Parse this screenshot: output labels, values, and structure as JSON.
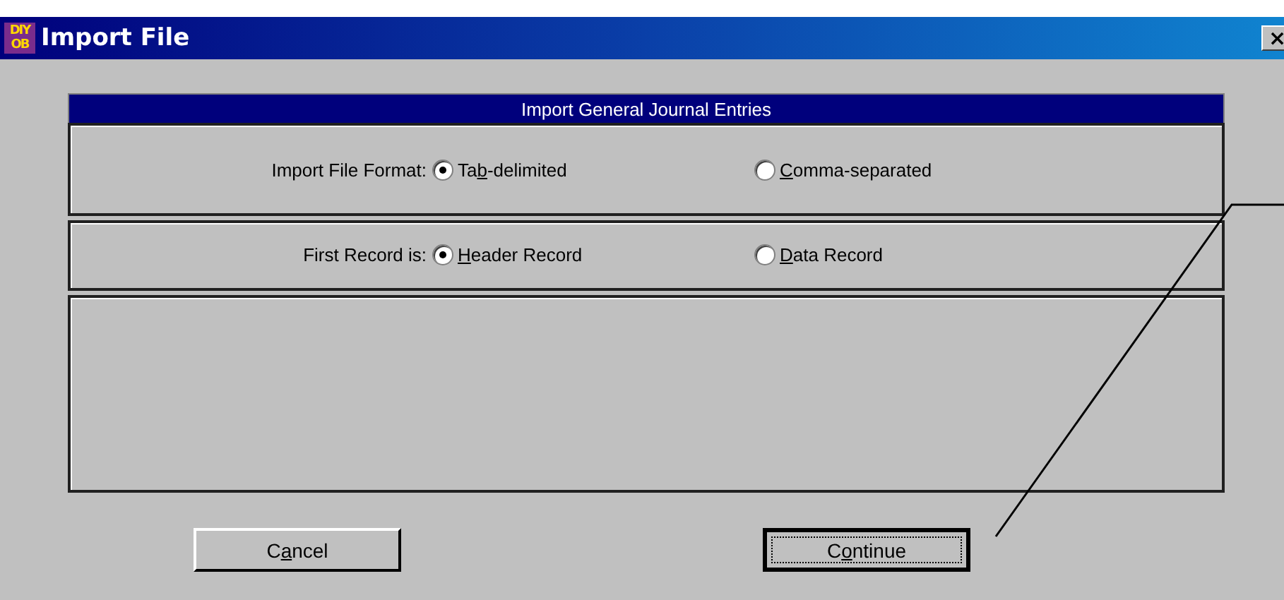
{
  "window": {
    "title": "Import File",
    "logo": [
      "DIY",
      "OB"
    ],
    "close": "×"
  },
  "panel_title": "Import General Journal Entries",
  "groups": [
    {
      "label": "Import File Format:",
      "options": [
        {
          "before": "Ta",
          "key": "b",
          "after": "-delimited",
          "selected": true
        },
        {
          "key": "C",
          "after": "omma-separated",
          "selected": false
        }
      ]
    },
    {
      "label": "First Record is:",
      "options": [
        {
          "key": "H",
          "after": "eader Record",
          "selected": true
        },
        {
          "key": "D",
          "after": "ata Record",
          "selected": false
        }
      ]
    }
  ],
  "buttons": [
    {
      "before": "C",
      "key": "a",
      "after": "ncel",
      "focused": false
    },
    {
      "before": "C",
      "key": "o",
      "after": "ntinue",
      "focused": true
    }
  ]
}
